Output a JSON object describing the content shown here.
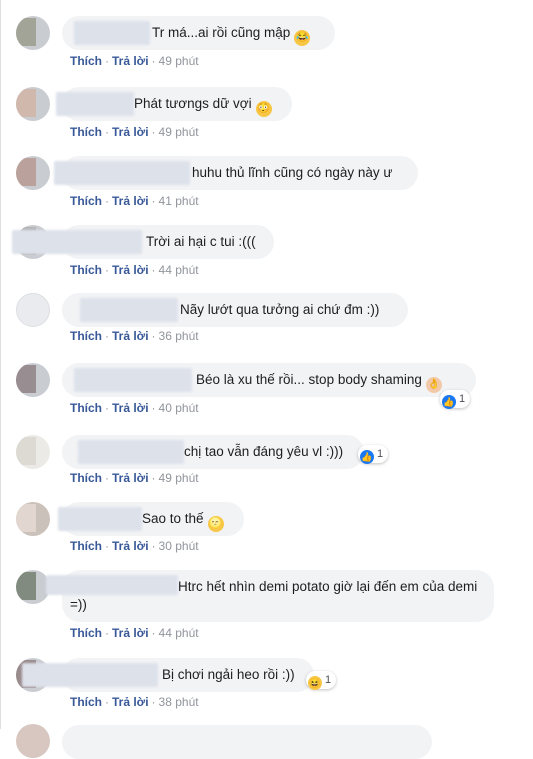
{
  "actions": {
    "like": "Thích",
    "reply": "Trả lời",
    "separator": "·"
  },
  "comments": [
    {
      "text": "Tr má...ai rồi cũng mập",
      "emoji": "😂",
      "time": "49 phút"
    },
    {
      "text": "Phát tươngs dữ vợi",
      "emoji": "😳",
      "time": "49 phút"
    },
    {
      "text": "huhu thủ lĩnh cũng có ngày này ư",
      "emoji": "",
      "time": "41 phút"
    },
    {
      "text": "Trời ai hại c tui :(((",
      "emoji": "",
      "time": "44 phút"
    },
    {
      "text": "Nãy lướt qua tưởng ai chứ đm :))",
      "emoji": "",
      "time": "36 phút"
    },
    {
      "text": "Béo là xu thế rồi... stop body shaming",
      "emoji": "👌",
      "time": "40 phút",
      "reaction_count": "1"
    },
    {
      "text": "chị tao vẫn đáng yêu vl :)))",
      "emoji": "",
      "time": "49 phút",
      "reaction_count": "1"
    },
    {
      "text": "Sao to thế",
      "emoji": "🌝",
      "time": "30 phút"
    },
    {
      "text": "Htrc hết nhìn demi potato giờ lại đến em của demi =))",
      "emoji": "",
      "time": "44 phút"
    },
    {
      "text": "Bị chơi ngải heo rồi :))",
      "emoji": "",
      "time": "38 phút",
      "reaction_count": "1"
    }
  ],
  "icons": {
    "like": "like-icon",
    "haha": "haha-icon"
  },
  "colors": {
    "link": "#385898",
    "bubble": "#f2f3f5",
    "like": "#1877f2",
    "meta": "#90949c"
  }
}
